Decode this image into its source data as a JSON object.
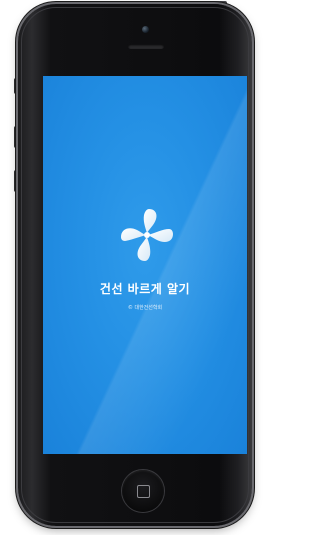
{
  "splash": {
    "app_title": "건선 바르게 알기",
    "copyright": "© 대한건선학회"
  },
  "icons": {
    "logo": "plus-cross-logo-icon",
    "home": "home-button-square-icon",
    "camera": "front-camera-icon",
    "speaker": "earpiece-speaker-icon"
  },
  "colors": {
    "screen_background": "#2490e4",
    "title_text": "#ffffff",
    "phone_body": "#111113"
  }
}
